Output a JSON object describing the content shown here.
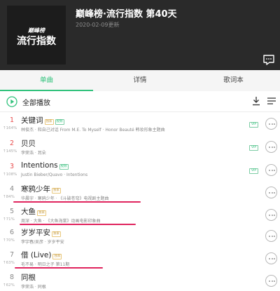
{
  "header": {
    "cover_small": "巅峰榜",
    "cover_big": "流行指数",
    "title": "巅峰榜·流行指数 第40天",
    "date": "2020-02-09更新"
  },
  "tabs": [
    {
      "label": "单曲",
      "active": true
    },
    {
      "label": "详情",
      "active": false
    },
    {
      "label": "歌词本",
      "active": false
    }
  ],
  "toolbar": {
    "play_all": "全部播放"
  },
  "colors": {
    "accent": "#31c27c",
    "rank_top": "#e84c4c",
    "highlight": "#e0245e"
  },
  "songs": [
    {
      "rank": "1",
      "trend": "↑164%",
      "title": "关键词",
      "badges": [
        "独家",
        "视频"
      ],
      "sub": "林俊杰 · 和自己对话 From M.E. To Myself · Honor Beauté 韩妆形象主题曲",
      "vip": "VIP"
    },
    {
      "rank": "2",
      "trend": "↑145%",
      "title": "贝贝",
      "badges": [],
      "sub": "李荣浩 · 耳朵",
      "vip": "VIP"
    },
    {
      "rank": "3",
      "trend": "↑108%",
      "title": "Intentions",
      "badges": [
        "视频"
      ],
      "sub": "Justin Bieber/Quavo · Intentions",
      "vip": "VIP"
    },
    {
      "rank": "4",
      "trend": "↑84%",
      "title": "寒鸦少年",
      "badges": [
        "独家"
      ],
      "sub": "华晨宇 · 寒鸦少年 · 《斗破苍穹》电视剧主题曲",
      "vip": ""
    },
    {
      "rank": "5",
      "trend": "↑71%",
      "title": "大鱼",
      "badges": [
        "独家"
      ],
      "sub": "周深 · 大鱼 · 《大鱼海棠》动画电影印象曲",
      "vip": ""
    },
    {
      "rank": "6",
      "trend": "↑70%",
      "title": "岁岁平安",
      "badges": [
        "独家"
      ],
      "sub": "李宇春/吴彦 · 岁岁平安",
      "vip": ""
    },
    {
      "rank": "7",
      "trend": "↑63%",
      "title": "借 (Live)",
      "badges": [
        "独家"
      ],
      "sub": "毛不易 · 明日之子 第11期",
      "vip": ""
    },
    {
      "rank": "8",
      "trend": "↑62%",
      "title": "同根",
      "badges": [],
      "sub": "李荣浩 · 同根",
      "vip": ""
    }
  ]
}
